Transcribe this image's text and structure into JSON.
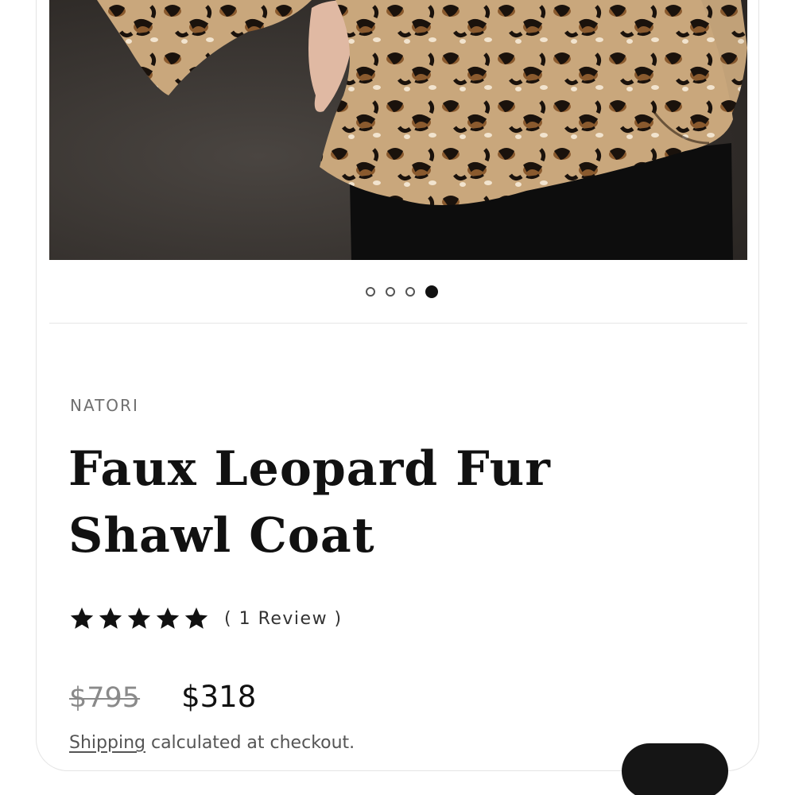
{
  "product": {
    "image_alt": "Faux Leopard Fur Shawl Coat",
    "brand": "NATORI",
    "title": "Faux Leopard Fur Shawl Coat",
    "rating": {
      "stars": 5,
      "review_text": "( 1 Review )"
    },
    "compare_price": "$795",
    "price": "$318",
    "shipping": {
      "link_text": "Shipping",
      "text": " calculated at checkout."
    }
  },
  "carousel": {
    "slide_count": 4,
    "active_index": 3
  },
  "icons": {
    "star": "star-icon"
  },
  "colors": {
    "text": "#111111",
    "muted": "#6f6f6f",
    "button": "#151515"
  }
}
